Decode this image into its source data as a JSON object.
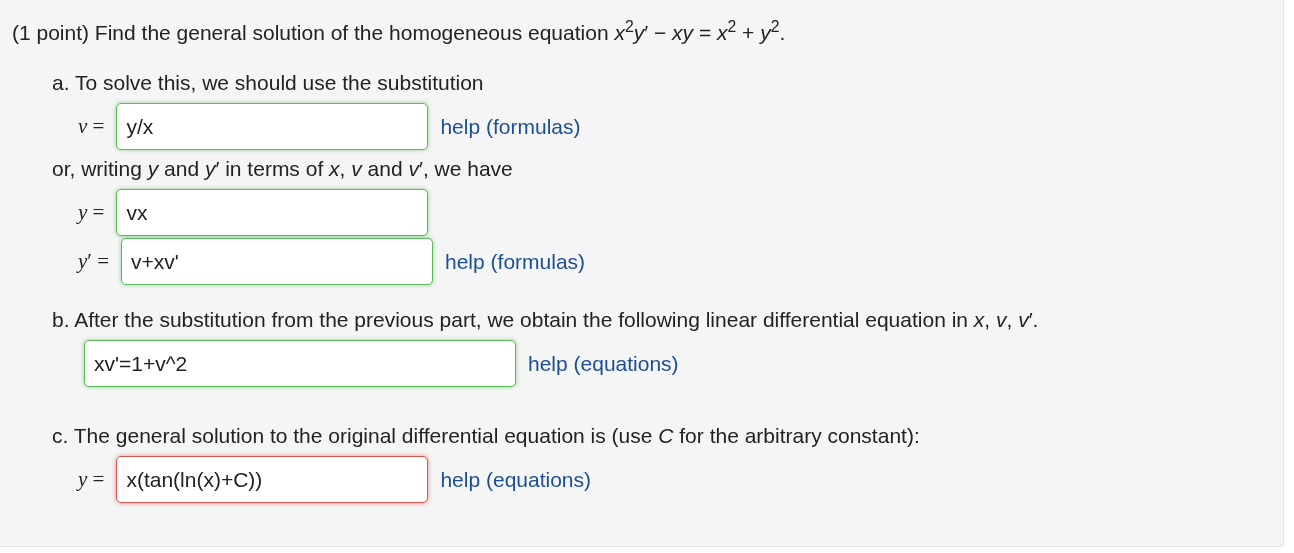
{
  "problem": {
    "statement": "(1 point) Find the general solution of the homogeneous equation *x*$^{2}$*y*′ − *xy* = *x*$^{2}$ + *y*$^{2}$.",
    "parts": [
      {
        "items": [
          {
            "kind": "text",
            "text": "a. To solve this, we should use the substitution"
          },
          {
            "kind": "answer",
            "label": "*v* =",
            "answer": "y/x",
            "correct": true,
            "help": "help (formulas)"
          },
          {
            "kind": "text",
            "text": "or, writing *y* and *y*′ in terms of *x*, *v* and *v*′, we have"
          },
          {
            "kind": "answer",
            "label": "*y* =",
            "answer": "vx",
            "correct": true
          },
          {
            "kind": "answer",
            "label": "*y*′ =",
            "answer": "v+xv'",
            "correct": true,
            "help": "help (formulas)"
          }
        ]
      },
      {
        "items": [
          {
            "kind": "text",
            "text": "b. After the substitution from the previous part, we obtain the following linear differential equation in *x*, *v*, *v*′."
          },
          {
            "kind": "answer",
            "answer": "xv'=1+v^2",
            "correct": true,
            "help": "help (equations)"
          }
        ]
      },
      {
        "items": [
          {
            "kind": "text",
            "text": "c. The general solution to the original differential equation is (use *C* for the arbitrary constant):"
          },
          {
            "kind": "answer",
            "label": "*y* =",
            "answer": "x(tan(ln(x)+C))",
            "correct": false,
            "help": "help (equations)"
          }
        ]
      }
    ]
  }
}
